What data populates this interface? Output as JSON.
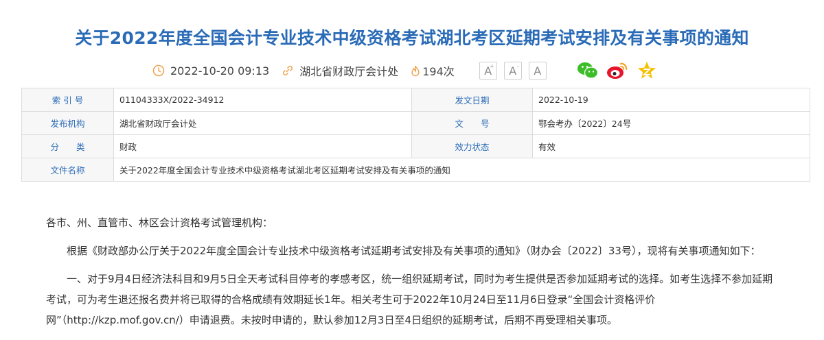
{
  "article": {
    "title": "关于2022年度全国会计专业技术中级资格考试湖北考区延期考试安排及有关事项的通知",
    "datetime": "2022-10-20 09:13",
    "source": "湖北省财政厅会计处",
    "views": "194次"
  },
  "toolbar": {
    "font_large": "A",
    "font_small": "A",
    "font_reset": "A"
  },
  "share": {
    "wechat_color": "#3dbd2a",
    "weibo_color": "#e6162d",
    "qzone_color": "#f5c000"
  },
  "info_table": {
    "rows": [
      {
        "l1": "索 引 号",
        "v1": "01104333X/2022-34912",
        "l2": "发文日期",
        "v2": "2022-10-19"
      },
      {
        "l1": "发布机构",
        "v1": "湖北省财政厅会计处",
        "l2": "文　　号",
        "v2": "鄂会考办〔2022〕24号"
      },
      {
        "l1": "分　　类",
        "v1": "财政",
        "l2": "效力状态",
        "v2": "有效"
      }
    ],
    "file_label": "文件名称",
    "file_value": "关于2022年度全国会计专业技术中级资格考试湖北考区延期考试安排及有关事项的通知"
  },
  "content": {
    "salutation": "各市、州、直管市、林区会计资格考试管理机构：",
    "p1": "根据《财政部办公厅关于2022年度全国会计专业技术中级资格考试延期考试安排及有关事项的通知》（财办会〔2022〕33号），现将有关事项通知如下：",
    "p2": "一、对于9月4日经济法科目和9月5日全天考试科目停考的孝感考区，统一组织延期考试，同时为考生提供是否参加延期考试的选择。如考生选择不参加延期考试，可为考生退还报名费并将已取得的合格成绩有效期延长1年。相关考生可于2022年10月24日至11月6日登录“全国会计资格评价网”（http://kzp.mof.gov.cn/）申请退费。未按时申请的，默认参加12月3日至4日组织的延期考试，后期不再受理相关事项。"
  }
}
